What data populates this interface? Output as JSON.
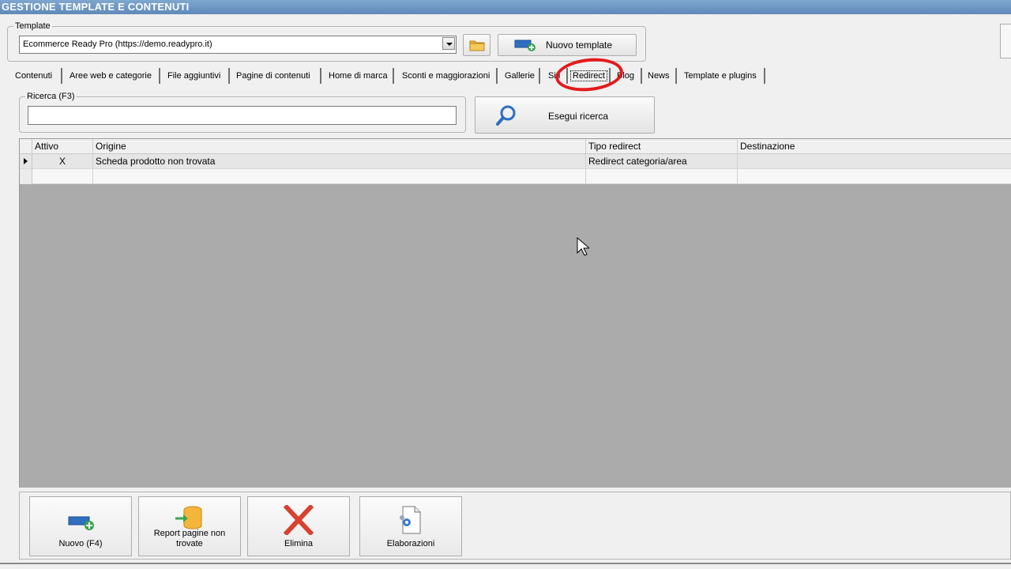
{
  "window": {
    "title": "GESTIONE TEMPLATE E CONTENUTI"
  },
  "template": {
    "label": "Template",
    "selected": "Ecommerce Ready Pro (https://demo.readypro.it)",
    "new_button": "Nuovo template"
  },
  "tabs": [
    "Contenuti",
    "Aree web e categorie",
    "File aggiuntivi",
    "Pagine di contenuti",
    "Home di marca",
    "Sconti e maggiorazioni",
    "Gallerie",
    "Siti",
    "Redirect",
    "Blog",
    "News",
    "Template e plugins"
  ],
  "active_tab": "Redirect",
  "search": {
    "label": "Ricerca (F3)",
    "value": "",
    "button": "Esegui ricerca"
  },
  "grid": {
    "columns": [
      "Attivo",
      "Origine",
      "Tipo redirect",
      "Destinazione"
    ],
    "rows": [
      {
        "attivo": "X",
        "origine": "Scheda prodotto non trovata",
        "tipo": "Redirect categoria/area",
        "destinazione": ""
      }
    ]
  },
  "toolbar": {
    "new": "Nuovo (F4)",
    "report": "Report pagine non trovate",
    "delete": "Elimina",
    "process": "Elaborazioni"
  },
  "colors": {
    "title_bar": "#6b93c0",
    "highlight": "#e31b1b",
    "grid_background": "#ababab"
  }
}
